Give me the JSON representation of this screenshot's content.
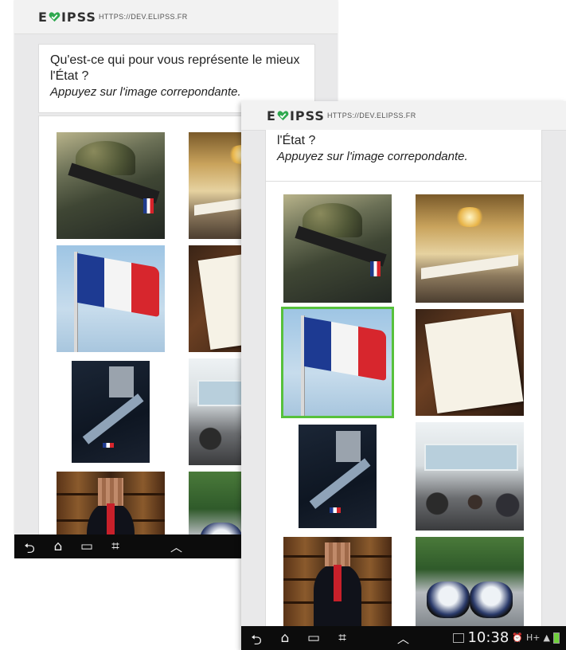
{
  "app": {
    "logo_left": "E",
    "logo_right": "IPSS",
    "url": "HTTPS://DEV.ELIPSS.FR",
    "accent_color": "#2fa84f"
  },
  "question": {
    "text_full": "Qu'est-ce qui pour vous représente le mieux l'État ?",
    "text_partial": "l'État ?",
    "hint": "Appuyez sur l'image correpondante."
  },
  "images": [
    {
      "name": "soldier",
      "label": "soldat"
    },
    {
      "name": "elysee-hall",
      "label": "salle"
    },
    {
      "name": "french-flag",
      "label": "drapeau",
      "selected": true
    },
    {
      "name": "constitution-book",
      "label": "constitution"
    },
    {
      "name": "poster",
      "label": "affiche"
    },
    {
      "name": "public-office",
      "label": "bureau"
    },
    {
      "name": "official-portrait",
      "label": "portrait"
    },
    {
      "name": "police-motorcycles",
      "label": "motards"
    }
  ],
  "selection": {
    "border_color": "#57c13c"
  },
  "status_bar": {
    "time": "10:38",
    "network": "H+"
  },
  "nav": {
    "back_glyph": "⮌",
    "home_glyph": "⌂",
    "recent_glyph": "▭",
    "screenshot_glyph": "⌗",
    "up_glyph": "︿"
  }
}
